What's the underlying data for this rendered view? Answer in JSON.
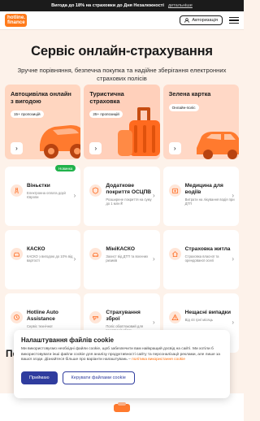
{
  "promo": {
    "text": "Вигода до 18% на страховки до Дня Незалежності",
    "more": "детальніше"
  },
  "header": {
    "logo_line1": "hotline.",
    "logo_line2": "finance",
    "login_label": "Авторизація"
  },
  "hero": {
    "title": "Сервіс онлайн-страхування",
    "subtitle": "Зручне порівняння, безпечна покупка та надійне зберігання електронних страхових полісів"
  },
  "featured": [
    {
      "title": "Автоцивілка онлайн з вигодою",
      "pill": "15+ пропозицій"
    },
    {
      "title": "Туристична страховка",
      "pill": "25+ пропозицій"
    },
    {
      "title": "Зелена картка",
      "pill": "Онлайн-поліс"
    }
  ],
  "tiles": [
    {
      "title": "Віньєтки",
      "desc": "Електронна оплата доріг Європи",
      "badge": "Новинка",
      "icon": "road-icon"
    },
    {
      "title": "Додаткове покриття ОСЦПВ",
      "desc": "Розширене покриття на суму до 1 млн ₴",
      "icon": "car-shield-icon"
    },
    {
      "title": "Медицина для водіїв",
      "desc": "Витрати на лікування водія при ДТП",
      "icon": "medical-icon"
    },
    {
      "title": "КАСКО",
      "desc": "КАСКО з вигодою до 10% від вартості",
      "icon": "car-icon"
    },
    {
      "title": "МініКАСКО",
      "desc": "Захист від ДТП та воєнних ризиків",
      "icon": "car-mini-icon"
    },
    {
      "title": "Страховка житла",
      "desc": "Страховка власної та орендованої оселі",
      "icon": "home-icon"
    },
    {
      "title": "Hotline Auto Assistance",
      "desc": "Сервіс технічної",
      "icon": "assistance-icon"
    },
    {
      "title": "Страхування зброї",
      "desc": "Поліс обов’язковий для реєстрації зброї",
      "icon": "weapon-icon"
    },
    {
      "title": "Нещасні випадки",
      "desc": "Від 44 грн/ місяць",
      "icon": "accident-icon"
    }
  ],
  "peek_title": "Пе",
  "cookie": {
    "title": "Налаштування файлів cookie",
    "text": "Ми використовуємо необхідні файли cookie, щоб забезпечити вам найкращий досвід на сайті. Ми хотіли б використовувати інші файли cookie для аналізу продуктивності сайту та персоналізації реклами, але лише за вашої згоди. Дізнайтеся більше про варіанти налаштувань – ",
    "link": "політика використання cookie",
    "accept": "Приймаю",
    "manage": "Керувати файлами cookie"
  },
  "colors": {
    "accent": "#ff7a1a",
    "cookie_button": "#2f3c9e",
    "badge_new": "#21b24b",
    "background": "#fdf2ea"
  }
}
